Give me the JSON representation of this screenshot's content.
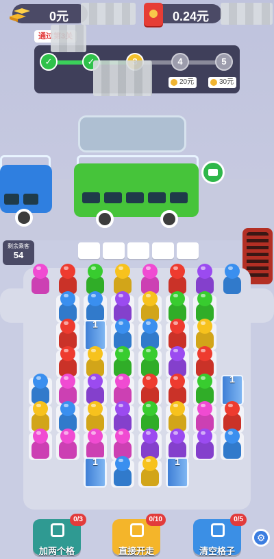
{
  "header": {
    "cash_left": "0元",
    "cash_right": "0.24元"
  },
  "progress": {
    "stage_prefix": "通过第3关",
    "nodes": [
      "",
      "",
      "3",
      "4",
      "5"
    ],
    "rewards": [
      "20元",
      "30元"
    ]
  },
  "queue": {
    "remaining_label": "剩余乘客",
    "remaining_count": "54",
    "lock_number": "1"
  },
  "buttons": [
    {
      "label": "加两个格",
      "count": "0/3",
      "color": "#2f9a92"
    },
    {
      "label": "直接开走",
      "count": "0/10",
      "color": "#f4b52a"
    },
    {
      "label": "清空格子",
      "count": "0/5",
      "color": "#3b8fe5"
    }
  ],
  "colors": {
    "pink": "#f04bd2",
    "red": "#ee3b2f",
    "green": "#38cc2f",
    "yellow": "#f7c21d",
    "purple": "#9b4bf0",
    "blue": "#3a8fef",
    "bus_green": "#46c43a",
    "bus_blue": "#2f7fe0"
  },
  "grid": [
    [
      "pink",
      "red",
      "green",
      "yellow",
      "pink",
      "red",
      "purple",
      "blue"
    ],
    [
      "",
      "blue",
      "blue",
      "purple",
      "yellow",
      "green",
      "green",
      ""
    ],
    [
      "",
      "red",
      "lock",
      "blue",
      "blue",
      "red",
      "yellow",
      ""
    ],
    [
      "",
      "red",
      "yellow",
      "green",
      "green",
      "purple",
      "red",
      ""
    ],
    [
      "blue",
      "pink",
      "purple",
      "pink",
      "red",
      "red",
      "green",
      "lock"
    ],
    [
      "yellow",
      "blue",
      "yellow",
      "purple",
      "green",
      "yellow",
      "pink",
      "red"
    ],
    [
      "pink",
      "pink",
      "pink",
      "pink",
      "purple",
      "purple",
      "purple",
      "blue"
    ],
    [
      "",
      "",
      "lock",
      "blue",
      "yellow",
      "lock",
      "",
      ""
    ]
  ]
}
